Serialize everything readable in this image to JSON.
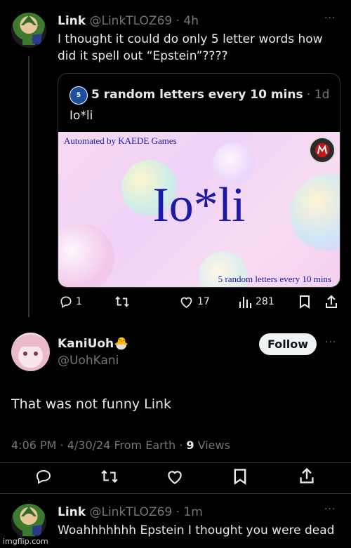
{
  "tweet1": {
    "name": "Link",
    "handle": "@LinkTLOZ69",
    "time": "· 4h",
    "text": "I thought it could do only 5 letter words how did it spell out “Epstein”????",
    "more": "···"
  },
  "quote": {
    "name": "5 random letters every 10 mins",
    "time": "· 1d",
    "text": "Io*li",
    "image": {
      "top_left": "Automated by KAEDE Games",
      "big_text": "Io*li",
      "bottom_right": "5 random letters every 10 mins"
    }
  },
  "tweet1_actions": {
    "replies": "1",
    "likes": "17",
    "views": "281"
  },
  "tweet2": {
    "name": "KaniUoh",
    "emoji": "🐣",
    "handle": "@UohKani",
    "follow": "Follow",
    "more": "···",
    "text": "That was not funny Link",
    "meta_time": "4:06 PM · 4/30/24 From Earth · ",
    "meta_views_num": "9",
    "meta_views_label": " Views"
  },
  "tweet3": {
    "name": "Link",
    "handle": "@LinkTLOZ69",
    "time": "· 1m",
    "text": "Woahhhhhhh Epstein I thought you were dead",
    "more": "···"
  },
  "watermark": "imgflip.com",
  "colors": {
    "bg": "#000000",
    "text": "#e7e9ea",
    "muted": "#71767b",
    "divider": "#2f3336",
    "verified_blue": "#1d9bf0"
  }
}
